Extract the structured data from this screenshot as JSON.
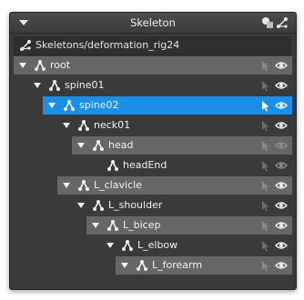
{
  "panel": {
    "title": "Skeleton"
  },
  "path": {
    "text": "Skeletons/deformation_rig24"
  },
  "tree": [
    {
      "label": "root",
      "expanded": true,
      "selected": false,
      "visible": true
    },
    {
      "label": "spine01",
      "expanded": true,
      "selected": false,
      "visible": true
    },
    {
      "label": "spine02",
      "expanded": true,
      "selected": true,
      "visible": true
    },
    {
      "label": "neck01",
      "expanded": true,
      "selected": false,
      "visible": true
    },
    {
      "label": "head",
      "expanded": true,
      "selected": false,
      "visible": false
    },
    {
      "label": "headEnd",
      "expanded": false,
      "selected": false,
      "visible": false
    },
    {
      "label": "L_clavicle",
      "expanded": true,
      "selected": false,
      "visible": true
    },
    {
      "label": "L_shoulder",
      "expanded": true,
      "selected": false,
      "visible": true
    },
    {
      "label": "L_bicep",
      "expanded": true,
      "selected": false,
      "visible": true
    },
    {
      "label": "L_elbow",
      "expanded": true,
      "selected": false,
      "visible": true
    },
    {
      "label": "L_forearm",
      "expanded": true,
      "selected": false,
      "visible": true
    }
  ],
  "colors": {
    "row": "#666666",
    "selected": "#1a8fe8",
    "panel": "#3a3a3a"
  }
}
